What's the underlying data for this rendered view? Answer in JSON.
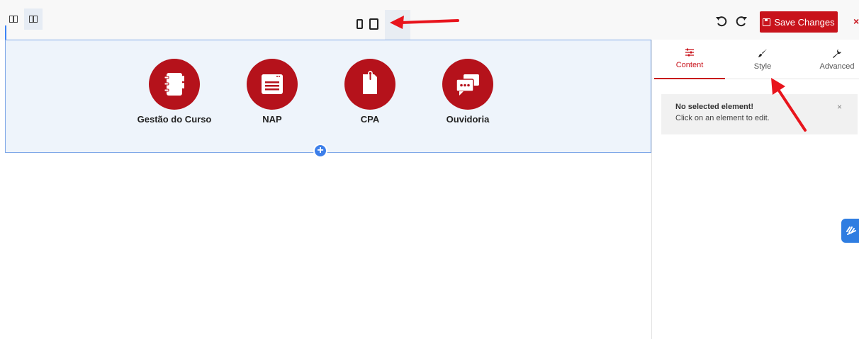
{
  "toolbar": {
    "save_label": "Save Changes",
    "close_label": "×"
  },
  "canvas": {
    "items": [
      {
        "label": "Gestão do Curso",
        "icon": "notebook-icon"
      },
      {
        "label": "NAP",
        "icon": "browser-list-icon"
      },
      {
        "label": "CPA",
        "icon": "clipped-document-icon"
      },
      {
        "label": "Ouvidoria",
        "icon": "chat-bubbles-icon"
      }
    ],
    "add_label": "+"
  },
  "sidebar": {
    "tabs": [
      {
        "label": "Content",
        "icon": "sliders-icon"
      },
      {
        "label": "Style",
        "icon": "paintbrush-icon"
      },
      {
        "label": "Advanced",
        "icon": "wrench-icon"
      }
    ],
    "notice": {
      "title": "No selected element!",
      "text": "Click on an element to edit.",
      "close": "×"
    }
  },
  "colors": {
    "brand_red": "#c8131b",
    "icon_circle": "#b5121b",
    "accent_blue": "#3d7fea",
    "annotation_red": "#e8141c"
  }
}
